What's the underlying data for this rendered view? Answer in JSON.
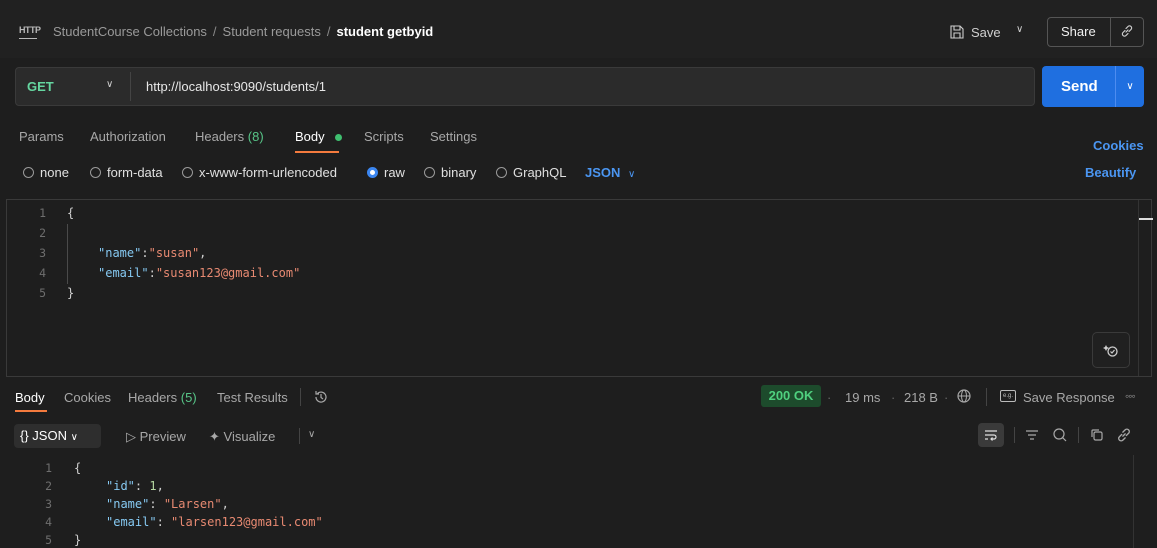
{
  "header": {
    "protocol_icon_text": "HTTP",
    "breadcrumb": [
      "StudentCourse Collections",
      "Student requests"
    ],
    "current_request": "student getbyid",
    "save_label": "Save",
    "share_label": "Share"
  },
  "request": {
    "method": "GET",
    "url": "http://localhost:9090/students/1",
    "send_label": "Send",
    "tabs": {
      "params": "Params",
      "authorization": "Authorization",
      "headers": "Headers",
      "headers_count": "(8)",
      "body": "Body",
      "scripts": "Scripts",
      "settings": "Settings"
    },
    "cookies_label": "Cookies",
    "body_types": [
      "none",
      "form-data",
      "x-www-form-urlencoded",
      "raw",
      "binary",
      "GraphQL"
    ],
    "selected_body_type": "raw",
    "format": "JSON",
    "beautify_label": "Beautify",
    "editor_lines": {
      "n1": "1",
      "n2": "2",
      "n3": "3",
      "n4": "4",
      "n5": "5",
      "open": "{",
      "name_key": "\"name\"",
      "name_val": "\"susan\"",
      "email_key": "\"email\"",
      "email_val": "\"susan123@gmail.com\"",
      "close": "}"
    }
  },
  "response": {
    "tabs": {
      "body": "Body",
      "cookies": "Cookies",
      "headers": "Headers",
      "headers_count": "(5)",
      "test_results": "Test Results"
    },
    "status": "200 OK",
    "time": "19 ms",
    "size": "218 B",
    "save_response_label": "Save Response",
    "format_label": "{} JSON",
    "preview_label": "Preview",
    "visualize_label": "Visualize",
    "editor_lines": {
      "n1": "1",
      "n2": "2",
      "n3": "3",
      "n4": "4",
      "n5": "5",
      "open": "{",
      "id_key": "\"id\"",
      "id_val": "1",
      "name_key": "\"name\"",
      "name_val": "\"Larsen\"",
      "email_key": "\"email\"",
      "email_val": "\"larsen123@gmail.com\"",
      "close": "}"
    }
  },
  "colors": {
    "accent_send": "#1f6fe0",
    "method_get": "#65d6a0",
    "status_ok": "#4fd07f",
    "tab_underline": "#f47b3e",
    "link_blue": "#4b96f2"
  },
  "icons": [
    "http-icon",
    "save-icon",
    "chevron-down-icon",
    "link-icon",
    "history-icon",
    "globe-icon",
    "save-response-icon",
    "more-icon",
    "preview-icon",
    "visualize-icon",
    "wrap-icon",
    "filter-icon",
    "search-icon",
    "copy-icon",
    "ai-assist-icon"
  ]
}
